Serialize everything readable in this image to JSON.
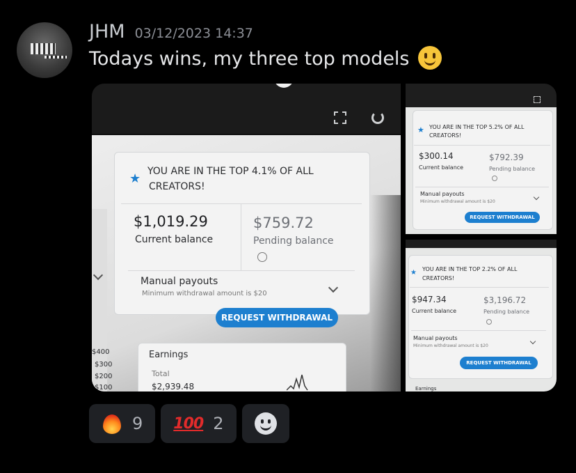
{
  "message": {
    "author": "JHM",
    "timestamp": "03/12/2023 14:37",
    "text": "Todays wins, my three top models"
  },
  "attachments": [
    {
      "banner": "YOU ARE IN THE TOP 4.1% OF ALL",
      "banner2": "CREATORS!",
      "current_balance": "$1,019.29",
      "current_label": "Current balance",
      "pending_balance": "$759.72",
      "pending_label": "Pending balance",
      "payouts_title": "Manual payouts",
      "payouts_sub": "Minimum withdrawal amount is $20",
      "withdraw_button": "REQUEST WITHDRAWAL",
      "earnings_title": "Earnings",
      "earnings_total_label": "Total",
      "earnings_total": "$2,939.48",
      "axis": [
        "$400",
        "$300",
        "$200",
        "$100"
      ]
    },
    {
      "banner": "YOU ARE IN THE TOP 5.2% OF ALL",
      "banner2": "CREATORS!",
      "current_balance": "$300.14",
      "current_label": "Current balance",
      "pending_balance": "$792.39",
      "pending_label": "Pending balance",
      "payouts_title": "Manual payouts",
      "payouts_sub": "Minimum withdrawal amount is $20",
      "withdraw_button": "REQUEST WITHDRAWAL"
    },
    {
      "banner": "YOU ARE IN THE TOP 2.2% OF ALL",
      "banner2": "CREATORS!",
      "current_balance": "$947.34",
      "current_label": "Current balance",
      "pending_balance": "$3,196.72",
      "pending_label": "Pending balance",
      "payouts_title": "Manual payouts",
      "payouts_sub": "Minimum withdrawal amount is $20",
      "withdraw_button": "REQUEST WITHDRAWAL",
      "earnings_title": "Earnings"
    }
  ],
  "reactions": [
    {
      "emoji": "fire-icon",
      "count": "9"
    },
    {
      "emoji": "hundred-points-icon",
      "label": "100",
      "count": "2"
    }
  ],
  "colors": {
    "accent": "#1d7fcf",
    "background": "#000000",
    "reaction_bg": "#1f2125"
  }
}
